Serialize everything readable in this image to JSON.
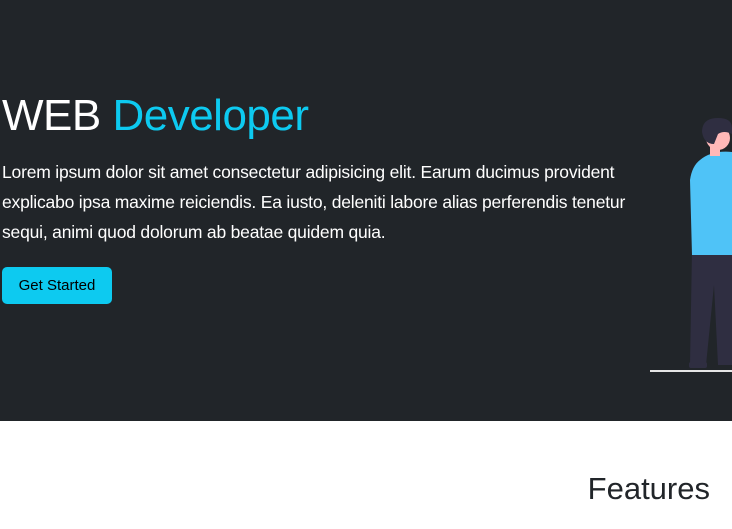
{
  "hero": {
    "title_plain": "WEB",
    "title_accent": "Developer",
    "description": "Lorem ipsum dolor sit amet consectetur adipisicing elit. Earum ducimus provident explicabo ipsa maxime reiciendis. Ea iusto, deleniti labore alias perferendis tenetur sequi, animi quod dolorum ab beatae quidem quia.",
    "cta_label": "Get Started",
    "illustration": "person-standing-illustration"
  },
  "features": {
    "title": "Features"
  },
  "colors": {
    "hero_background": "#212529",
    "accent": "#0dcaf0",
    "figure_shirt": "#4fc3f7",
    "figure_pants": "#2f2e41"
  }
}
